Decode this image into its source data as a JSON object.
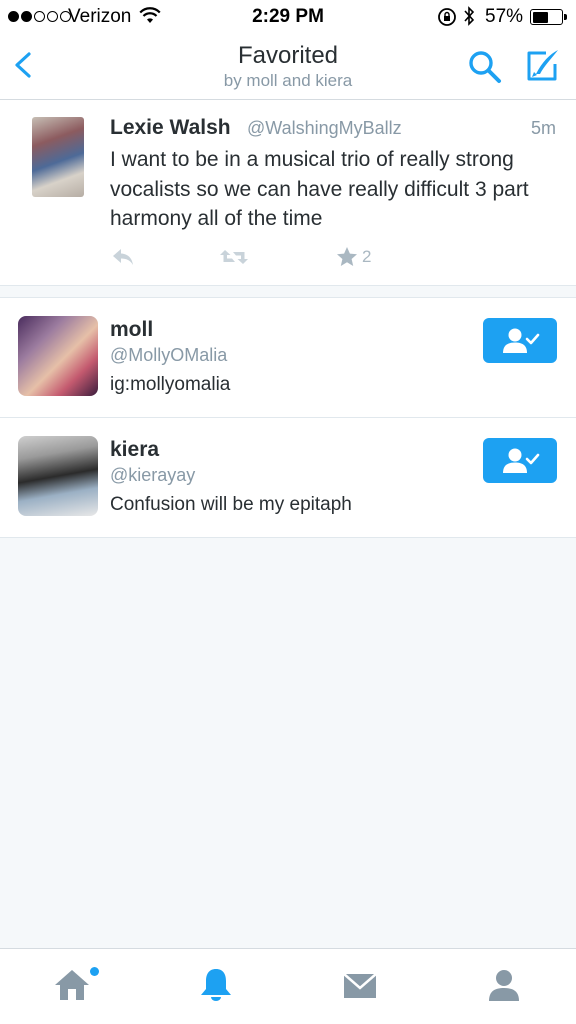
{
  "status_bar": {
    "carrier": "Verizon",
    "time": "2:29 PM",
    "battery_percent": "57%",
    "battery_level": 0.57,
    "signal_bars": 2,
    "icons": [
      "signal-dots-icon",
      "wifi-icon",
      "rotation-lock-icon",
      "bluetooth-icon",
      "battery-icon"
    ]
  },
  "header": {
    "title": "Favorited",
    "subtitle": "by moll and kiera",
    "icons": [
      "back-chevron-icon",
      "search-icon",
      "compose-icon"
    ]
  },
  "tweet": {
    "name": "Lexie Walsh",
    "handle": "@WalshingMyBallz",
    "age": "5m",
    "text": "I want to be in a musical trio of really strong vocalists so we can have really difficult 3 part harmony all of the time",
    "favorite_count": "2",
    "icons": [
      "reply-icon",
      "retweet-icon",
      "star-icon"
    ]
  },
  "users": [
    {
      "name": "moll",
      "handle": "@MollyOMalia",
      "bio": "ig:mollyomalia",
      "following": true
    },
    {
      "name": "kiera",
      "handle": "@kierayay",
      "bio": "Confusion will be my epitaph",
      "following": true
    }
  ],
  "tabbar": {
    "tabs": [
      "home",
      "notifications",
      "messages",
      "me"
    ],
    "active": "notifications",
    "icons": [
      "home-icon",
      "bell-icon",
      "envelope-icon",
      "person-icon"
    ]
  },
  "colors": {
    "accent": "#1da1f2",
    "text": "#292f33",
    "muted": "#8899a6",
    "background": "#f5f8fa"
  }
}
